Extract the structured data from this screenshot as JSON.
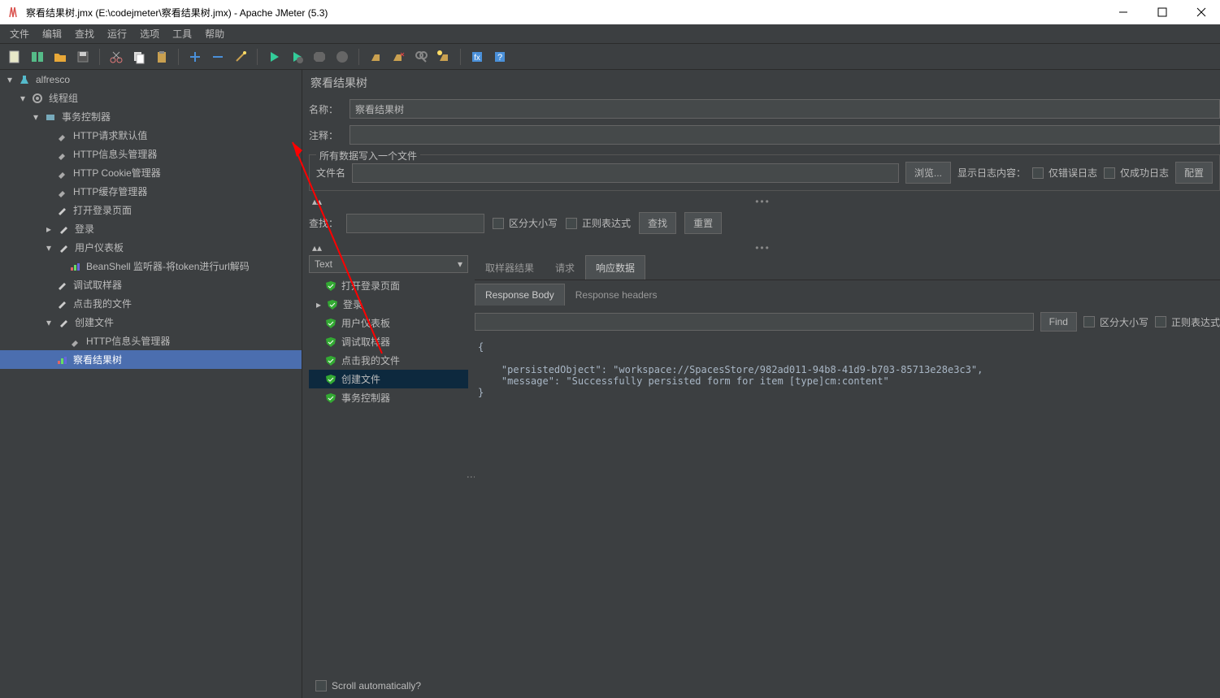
{
  "window": {
    "title": "察看结果树.jmx (E:\\codejmeter\\察看结果树.jmx) - Apache JMeter (5.3)"
  },
  "menu": {
    "items": [
      "文件",
      "编辑",
      "查找",
      "运行",
      "选项",
      "工具",
      "帮助"
    ]
  },
  "tree": {
    "root": "alfresco",
    "threadGroup": "线程组",
    "txnController": "事务控制器",
    "items": [
      "HTTP请求默认值",
      "HTTP信息头管理器",
      "HTTP Cookie管理器",
      "HTTP缓存管理器",
      "打开登录页面"
    ],
    "login": "登录",
    "userDashboard": "用户仪表板",
    "beanshell": "BeanShell 监听器-将token进行url解码",
    "debugSampler": "调试取样器",
    "clickMyFile": "点击我的文件",
    "createFile": "创建文件",
    "headerMgr2": "HTTP信息头管理器",
    "resultTree": "察看结果树"
  },
  "panel": {
    "title": "察看结果树",
    "nameLabel": "名称：",
    "nameValue": "察看结果树",
    "commentLabel": "注释：",
    "commentValue": "",
    "fileFieldset": "所有数据写入一个文件",
    "filenameLabel": "文件名",
    "filenameValue": "",
    "browseBtn": "浏览...",
    "showLogLabel": "显示日志内容：",
    "errorOnlyLabel": "仅错误日志",
    "successOnlyLabel": "仅成功日志",
    "configBtn": "配置",
    "searchLabel": "查找：",
    "caseSensitive": "区分大小写",
    "regex": "正则表达式",
    "searchBtn": "查找",
    "resetBtn": "重置"
  },
  "resultType": "Text",
  "resultTree": {
    "items": [
      "打开登录页面",
      "登录",
      "用户仪表板",
      "调试取样器",
      "点击我的文件",
      "创建文件",
      "事务控制器"
    ],
    "selectedIndex": 5
  },
  "scrollAuto": "Scroll automatically?",
  "tabs": {
    "main": [
      "取样器结果",
      "请求",
      "响应数据"
    ],
    "mainActive": 2,
    "sub": [
      "Response Body",
      "Response headers"
    ],
    "subActive": 0
  },
  "find": {
    "btn": "Find",
    "case": "区分大小写",
    "regex": "正则表达式"
  },
  "responseBody": "{\n\n    \"persistedObject\": \"workspace://SpacesStore/982ad011-94b8-41d9-b703-85713e28e3c3\",\n    \"message\": \"Successfully persisted form for item [type]cm:content\"\n}"
}
